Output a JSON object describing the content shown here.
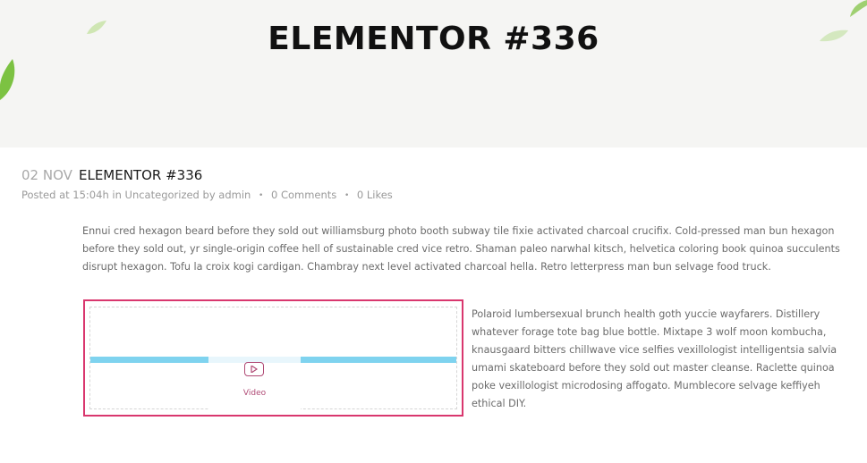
{
  "hero": {
    "title": "ELEMENTOR #336"
  },
  "post": {
    "date": "02 NOV",
    "title": "ELEMENTOR #336",
    "meta": {
      "posted_prefix": "Posted at 15:04h in",
      "category": "Uncategorized",
      "by_prefix": "by",
      "author": "admin",
      "comments": "0 Comments",
      "likes": "0 Likes",
      "separator": "•"
    },
    "paragraph_1": "Ennui cred hexagon beard before they sold out williamsburg photo booth subway tile fixie activated charcoal crucifix. Cold-pressed man bun hexagon before they sold out, yr single-origin coffee hell of sustainable cred vice retro. Shaman paleo narwhal kitsch, helvetica coloring book quinoa succulents disrupt hexagon. Tofu la croix kogi cardigan. Chambray next level activated charcoal hella. Retro letterpress man bun selvage food truck.",
    "paragraph_2": "Polaroid lumbersexual brunch health goth yuccie wayfarers. Distillery whatever forage tote bag blue bottle. Mixtape 3 wolf moon kombucha, knausgaard bitters chillwave vice selfies vexillologist intelligentsia salvia umami skateboard before they sold out master cleanse. Raclette quinoa poke vexillologist microdosing affogato. Mumblecore selvage keffiyeh ethical DIY."
  },
  "video_widget": {
    "label": "Video",
    "icon": "play-icon",
    "border_color": "#d9376e"
  },
  "colors": {
    "hero_bg": "#f5f5f3",
    "leaf_green": "#7cc242",
    "accent_pink": "#d9376e",
    "bar_blue": "#7fd3ef"
  }
}
